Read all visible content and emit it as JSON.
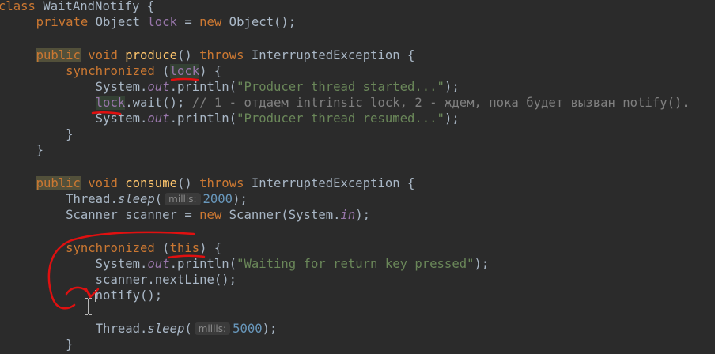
{
  "editor": {
    "lines": {
      "l1": {
        "indent": "",
        "kw": "class",
        "name": " WaitAndNotify {"
      },
      "l2": {
        "indent": "    ",
        "kw": "private",
        "a": " Object ",
        "field": "lock",
        "b": " = ",
        "kw2": "new",
        "c": " Object();"
      },
      "l3": {
        "indent": "    ",
        "kw": "public",
        "a": " ",
        "kw2": "void",
        "b": " ",
        "meth": "produce",
        "c": "() ",
        "kw3": "throws",
        "d": " InterruptedException {"
      },
      "l4": {
        "indent": "        ",
        "kw": "synchronized",
        "a": " (",
        "field": "lock",
        "b": ") {"
      },
      "l5": {
        "indent": "            ",
        "a": "System.",
        "fld": "out",
        "b": ".println(",
        "str": "\"Producer thread started...\"",
        "c": ");"
      },
      "l6": {
        "indent": "            ",
        "field": "lock",
        "a": ".wait(); ",
        "cmt": "// 1 - отдаем intrinsic lock, 2 - ждем, пока будет вызван notify()."
      },
      "l7": {
        "indent": "            ",
        "a": "System.",
        "fld": "out",
        "b": ".println(",
        "str": "\"Producer thread resumed...\"",
        "c": ");"
      },
      "l8": {
        "indent": "        ",
        "a": "}"
      },
      "l9": {
        "indent": "    ",
        "a": "}"
      },
      "l10": {
        "indent": "    ",
        "kw": "public",
        "a": " ",
        "kw2": "void",
        "b": " ",
        "meth": "consume",
        "c": "() ",
        "kw3": "throws",
        "d": " InterruptedException {"
      },
      "l11": {
        "indent": "        ",
        "a": "Thread.",
        "ital": "sleep",
        "b": "(",
        "hint": "millis:",
        "num": "2000",
        "c": ");"
      },
      "l12": {
        "indent": "        ",
        "a": "Scanner scanner = ",
        "kw": "new",
        "b": " Scanner(System.",
        "fld": "in",
        "c": ");"
      },
      "l13": {
        "indent": "        ",
        "kw": "synchronized",
        "a": " (",
        "kw2": "this",
        "b": ") {"
      },
      "l14": {
        "indent": "            ",
        "a": "System.",
        "fld": "out",
        "b": ".println(",
        "str": "\"Waiting for return key pressed\"",
        "c": ");"
      },
      "l15": {
        "indent": "            ",
        "a": "scanner.nextLine();"
      },
      "l16": {
        "indent": "            ",
        "a": "notify();"
      },
      "l17": {
        "indent": "            ",
        "a": "Thread.",
        "ital": "sleep",
        "b": "(",
        "hint": "millis:",
        "num": "5000",
        "c": ");"
      },
      "l18": {
        "indent": "        ",
        "a": "}"
      }
    }
  },
  "colors": {
    "background": "#2b2b2b",
    "keyword": "#cc7832",
    "method": "#ffc66d",
    "string": "#6a8759",
    "number": "#6897bb",
    "field": "#9876aa",
    "comment": "#808080",
    "annotation": "#e01010"
  },
  "icons": {
    "text-cursor": "i-beam-icon"
  }
}
